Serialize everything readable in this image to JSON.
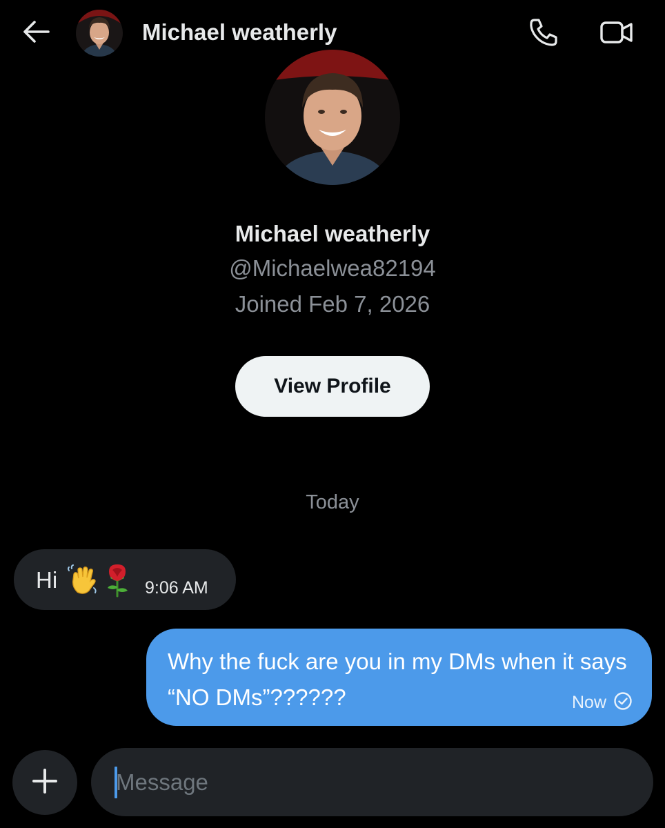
{
  "header": {
    "name": "Michael weatherly",
    "back_icon": "arrow-left-icon",
    "call_icon": "phone-icon",
    "video_icon": "video-camera-icon"
  },
  "profile": {
    "name": "Michael weatherly",
    "handle": "@Michaelwea82194",
    "joined": "Joined Feb 7, 2026",
    "view_profile_label": "View Profile"
  },
  "conversation": {
    "day_separator": "Today",
    "messages": [
      {
        "direction": "incoming",
        "text": "Hi",
        "emojis": [
          "👋",
          "🌹"
        ],
        "time": "9:06 AM"
      },
      {
        "direction": "outgoing",
        "text": "Why the fuck are you in my DMs when it says “NO DMs”??????",
        "time": "Now",
        "status_icon": "sent-check-icon"
      }
    ]
  },
  "composer": {
    "placeholder": "Message",
    "add_icon": "plus-icon"
  },
  "colors": {
    "background": "#000000",
    "bubble_incoming": "#202327",
    "bubble_outgoing": "#4c9aea",
    "secondary_text": "#8b9097",
    "button_light": "#eff3f4"
  }
}
